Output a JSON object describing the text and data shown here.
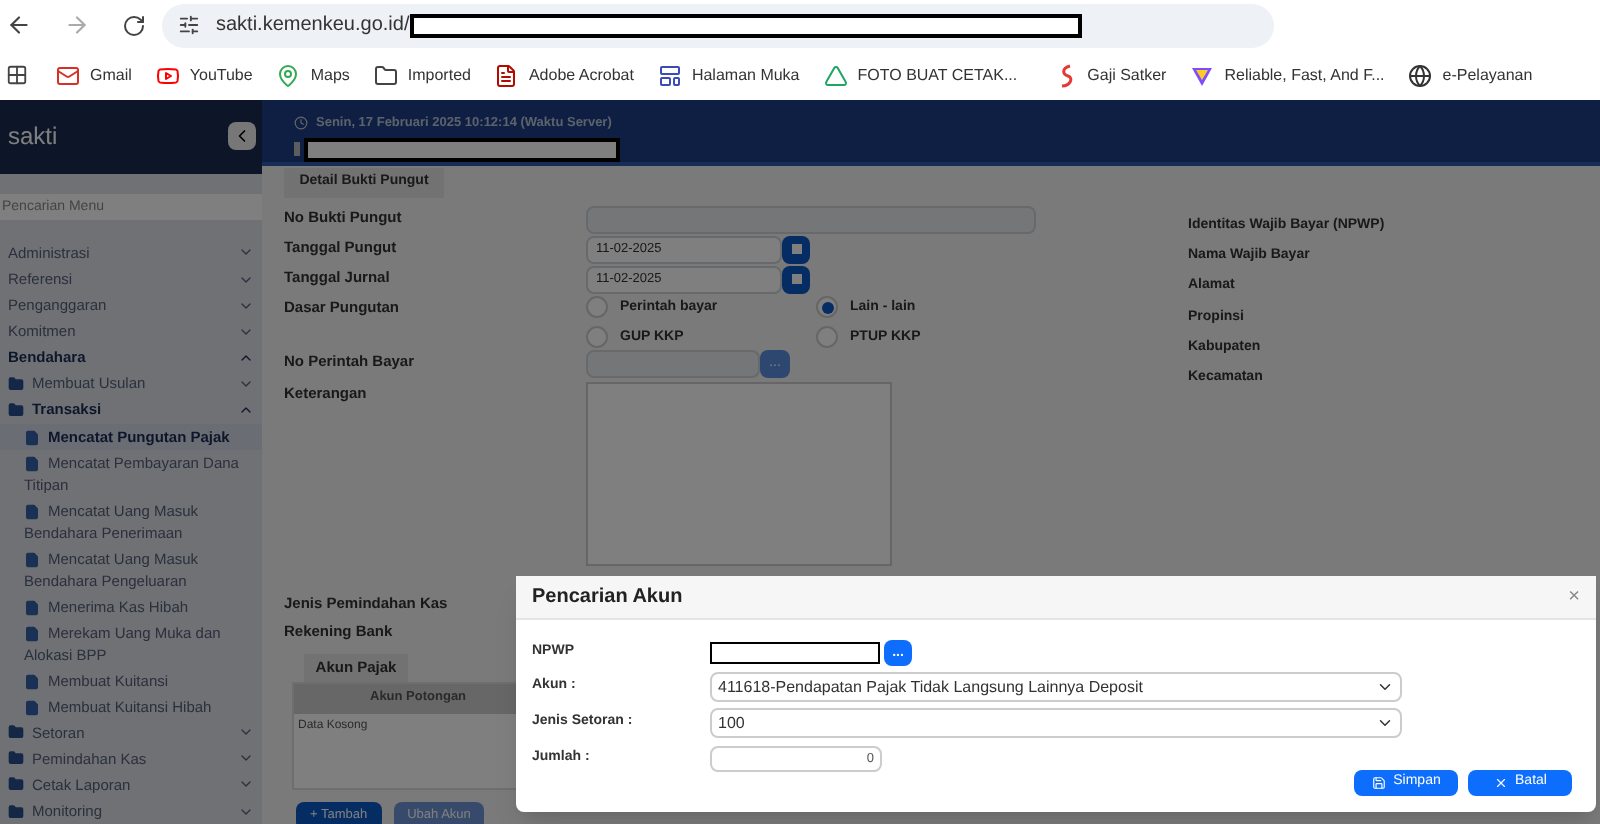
{
  "browser": {
    "url": "sakti.kemenkeu.go.id/",
    "bookmarks": [
      "Gmail",
      "YouTube",
      "Maps",
      "Imported",
      "Adobe Acrobat",
      "Halaman Muka",
      "FOTO BUAT CETAK...",
      "Gaji Satker",
      "Reliable, Fast, And F...",
      "e-Pelayanan"
    ]
  },
  "app": {
    "logo": "sakti",
    "server_time": "Senin, 17 Februari 2025 10:12:14 (Waktu Server)"
  },
  "sidebar": {
    "search_placeholder": "Pencarian Menu",
    "items": [
      {
        "label": "Administrasi",
        "expanded": false
      },
      {
        "label": "Referensi",
        "expanded": false
      },
      {
        "label": "Penganggaran",
        "expanded": false
      },
      {
        "label": "Komitmen",
        "expanded": false
      },
      {
        "label": "Bendahara",
        "expanded": true,
        "children": [
          {
            "label": "Membuat Usulan",
            "expanded": false
          },
          {
            "label": "Transaksi",
            "expanded": true,
            "children": [
              {
                "label": "Mencatat Pungutan Pajak",
                "selected": true
              },
              {
                "label": "Mencatat Pembayaran Dana Titipan",
                "selected": false
              },
              {
                "label": "Mencatat Uang Masuk Bendahara Penerimaan",
                "selected": false
              },
              {
                "label": "Mencatat Uang Masuk Bendahara Pengeluaran",
                "selected": false
              },
              {
                "label": "Menerima Kas Hibah",
                "selected": false
              },
              {
                "label": "Merekam Uang Muka dan Alokasi BPP",
                "selected": false
              },
              {
                "label": "Membuat Kuitansi",
                "selected": false
              },
              {
                "label": "Membuat Kuitansi Hibah",
                "selected": false
              }
            ]
          },
          {
            "label": "Setoran",
            "expanded": false
          },
          {
            "label": "Pemindahan Kas",
            "expanded": false
          },
          {
            "label": "Cetak Laporan",
            "expanded": false
          },
          {
            "label": "Monitoring",
            "expanded": false
          }
        ]
      }
    ]
  },
  "form": {
    "tab": "Detail Bukti Pungut",
    "fields": [
      {
        "kind": "text",
        "label": "No Bukti Pungut"
      },
      {
        "kind": "date",
        "label": "Tanggal Pungut",
        "value": "11-02-2025"
      },
      {
        "kind": "date",
        "label": "Tanggal Jurnal",
        "value": "11-02-2025"
      },
      {
        "kind": "radio",
        "label": "Dasar Pungutan",
        "options": [
          {
            "label": "Perintah bayar",
            "selected": false
          },
          {
            "label": "Lain - lain",
            "selected": true
          },
          {
            "label": "GUP KKP",
            "selected": false
          },
          {
            "label": "PTUP KKP",
            "selected": false
          }
        ]
      },
      {
        "kind": "lookup",
        "label": "No Perintah Bayar",
        "button": "..."
      },
      {
        "kind": "textarea",
        "label": "Keterangan"
      }
    ],
    "lower_labels": [
      "Jenis Pemindahan Kas",
      "Rekening Bank"
    ],
    "right_labels": [
      "Identitas Wajib Bayar (NPWP)",
      "Nama Wajib Bayar",
      "Alamat",
      "Propinsi",
      "Kabupaten",
      "Kecamatan"
    ],
    "akun_tab": "Akun Pajak",
    "table": {
      "columns": [
        "Akun Potongan"
      ],
      "empty": "Data Kosong"
    },
    "buttons": [
      "+ Tambah",
      "Ubah Akun"
    ]
  },
  "modal": {
    "title": "Pencarian Akun",
    "close": "×",
    "npwp": {
      "label": "NPWP",
      "button": "..."
    },
    "akun": {
      "label": "Akun :",
      "value": "411618-Pendapatan Pajak Tidak Langsung Lainnya Deposit"
    },
    "jenis_setoran": {
      "label": "Jenis Setoran :",
      "value": "100"
    },
    "jumlah": {
      "label": "Jumlah :",
      "value": "0"
    },
    "buttons": [
      "Simpan",
      "Batal"
    ]
  }
}
